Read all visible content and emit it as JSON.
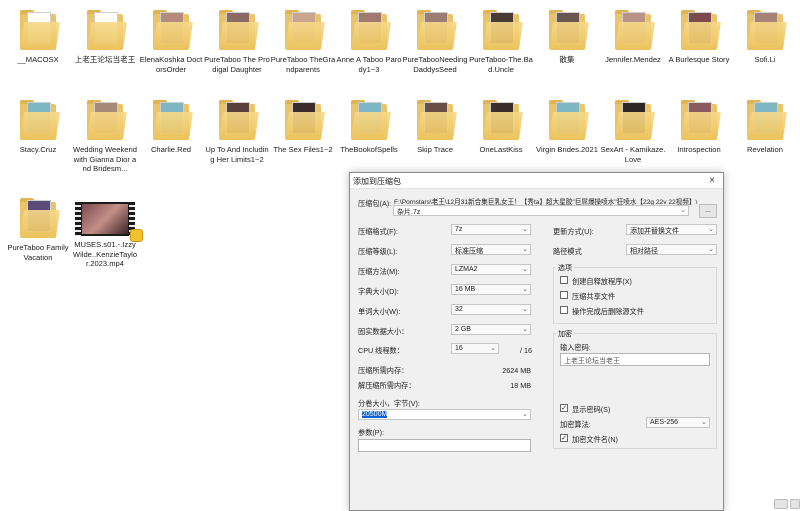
{
  "desktop": {
    "items": [
      {
        "label": "__MACOSX",
        "type": "folder",
        "paper": "#ffffff"
      },
      {
        "label": "上老王论坛当老王",
        "type": "folder",
        "paper": "#ffffff"
      },
      {
        "label": "ElenaKoshka DoctorsOrder",
        "type": "folder",
        "paper": "#b58a7a"
      },
      {
        "label": "PureTaboo The Prodigal Daughter",
        "type": "folder",
        "paper": "#8a6a62"
      },
      {
        "label": "PureTaboo TheGrandparents",
        "type": "folder",
        "paper": "#c9a58f"
      },
      {
        "label": "Anne A Taboo Parody1~3",
        "type": "folder",
        "paper": "#a07a6f"
      },
      {
        "label": "PureTabooNeedingDaddysSeed",
        "type": "folder",
        "paper": "#9a7c72"
      },
      {
        "label": "PureTaboo-The.Bad.Uncle",
        "type": "folder",
        "paper": "#4a3a36"
      },
      {
        "label": "散集",
        "type": "folder",
        "paper": "#6b5550"
      },
      {
        "label": "Jennifer.Mendez",
        "type": "folder",
        "paper": "#b99486"
      },
      {
        "label": "A Burlesque Story",
        "type": "folder",
        "paper": "#7a4a4e"
      },
      {
        "label": "Sofi.Li",
        "type": "folder",
        "paper": "#a88274"
      },
      {
        "label": "Stacy.Cruz",
        "type": "folder",
        "paper": "#7fb6c4"
      },
      {
        "label": "Wedding Weekend with Gianna Dior and Bridesm...",
        "type": "folder",
        "paper": "#a88a78"
      },
      {
        "label": "Charlie.Red",
        "type": "folder",
        "paper": "#7fb6c4"
      },
      {
        "label": "Up To And Including Her Limits1~2",
        "type": "folder",
        "paper": "#5a3f3a"
      },
      {
        "label": "The Sex Files1~2",
        "type": "folder",
        "paper": "#3d2c2a"
      },
      {
        "label": "TheBookofSpells",
        "type": "folder",
        "paper": "#7fb6c4"
      },
      {
        "label": "Skip Trace",
        "type": "folder",
        "paper": "#6a4e48"
      },
      {
        "label": "OneLastKiss",
        "type": "folder",
        "paper": "#3a2e2c"
      },
      {
        "label": "Virgin Brides.2021",
        "type": "folder",
        "paper": "#7fb6c4"
      },
      {
        "label": "SexArt - Kamikaze.Love",
        "type": "folder",
        "paper": "#2e2626"
      },
      {
        "label": "Introspection",
        "type": "folder",
        "paper": "#8a5a5e"
      },
      {
        "label": "Revelation",
        "type": "folder",
        "paper": "#7fb6c4"
      },
      {
        "label": "PureTaboo Family Vacation",
        "type": "folder",
        "paper": "#5b4a7a"
      },
      {
        "label": "MUSES.s01.-.IzzyWilde..KenzieTaylor.2023.mp4",
        "type": "video",
        "paper": "#7a4a52"
      }
    ]
  },
  "dialog": {
    "title": "添加到压缩包",
    "close_icon": "×",
    "archive_label": "压缩包(A):",
    "archive_path": "F:\\Pornstars\\老王\\12月31新合集巨乳女王！【秀ta】超大星胶\"巨屌爆操喷水\"狂喷水【22g 22v 22视频】\\",
    "archive_name": "杂片.7z",
    "browse_label": "...",
    "left": {
      "format_label": "压缩格式(F):",
      "format_value": "7z",
      "level_label": "压缩等级(L):",
      "level_value": "标准压缩",
      "method_label": "压缩方法(M):",
      "method_value": "LZMA2",
      "dict_label": "字典大小(D):",
      "dict_value": "16 MB",
      "word_label": "单词大小(W):",
      "word_value": "32",
      "solid_label": "固实数据大小：",
      "solid_value": "2 GB",
      "threads_label": "CPU 线程数：",
      "threads_value": "16",
      "threads_total": "/ 16",
      "mem_compress_label": "压缩所需内存：",
      "mem_compress_value": "2624 MB",
      "mem_decompress_label": "解压缩所需内存：",
      "mem_decompress_value": "18 MB",
      "split_label": "分卷大小，字节(V):",
      "split_value": "20500M",
      "params_label": "参数(P):",
      "params_value": ""
    },
    "right": {
      "update_label": "更新方式(U):",
      "update_value": "添加并替换文件",
      "path_label": "路径模式",
      "path_value": "相对路径",
      "options_title": "选项",
      "opt_sfx": "创建自释放程序(X)",
      "opt_shared": "压缩共享文件",
      "opt_delete": "操作完成后删除源文件",
      "encrypt_title": "加密",
      "password_label": "输入密码:",
      "password_value": "上老王论坛当老王",
      "show_password": "显示密码(S)",
      "enc_method_label": "加密算法:",
      "enc_method_value": "AES-256",
      "encrypt_names": "加密文件名(N)"
    }
  },
  "tray": {
    "icons": [
      "taskbar-window-icon",
      "taskbar-window-icon"
    ]
  }
}
